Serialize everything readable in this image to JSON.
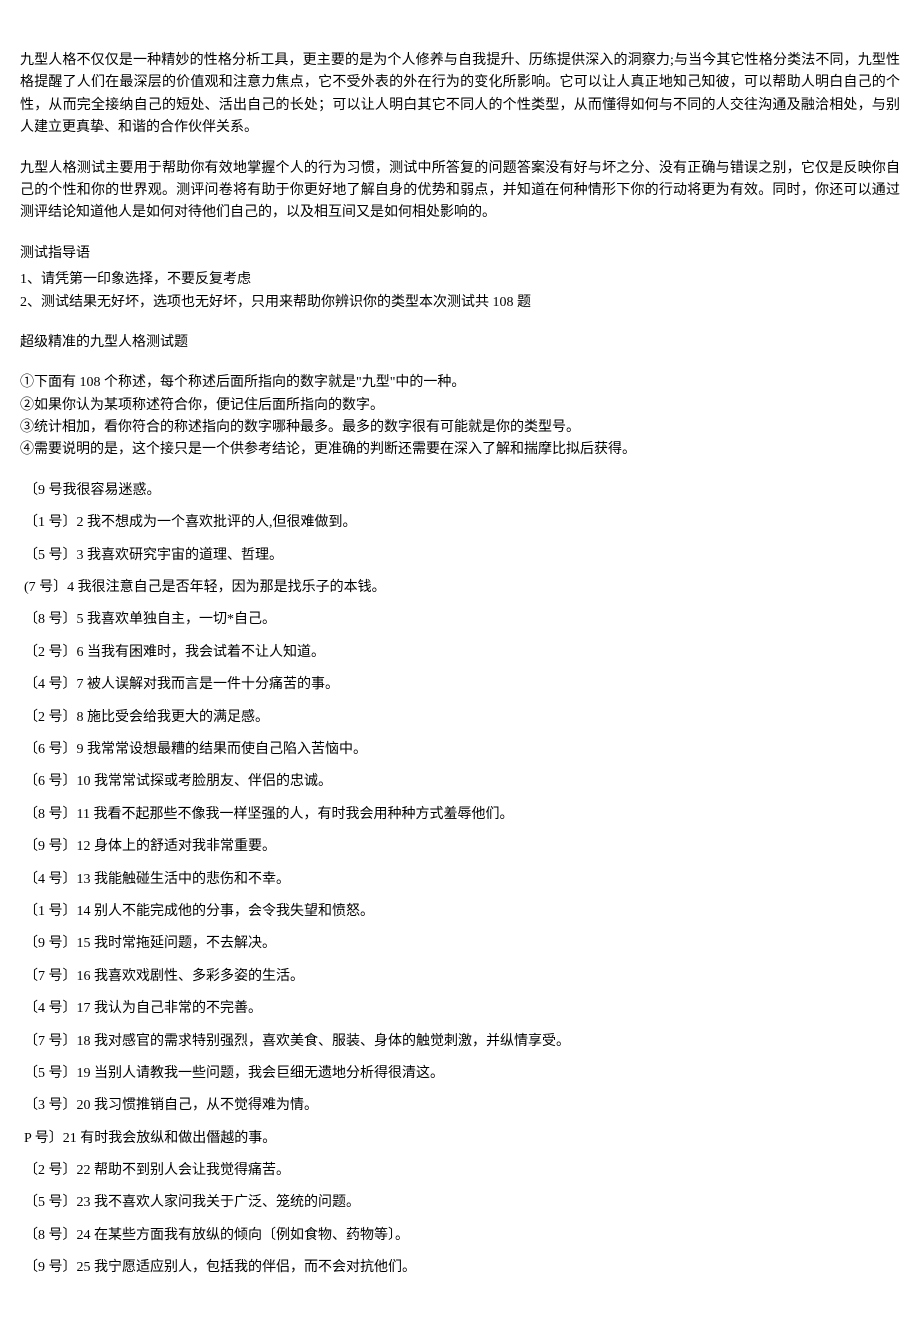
{
  "intro": {
    "p1": "九型人格不仅仅是一种精妙的性格分析工具，更主要的是为个人修养与自我提升、历练提供深入的洞察力;与当今其它性格分类法不同，九型性格提醒了人们在最深层的价值观和注意力焦点，它不受外表的外在行为的变化所影响。它可以让人真正地知己知彼，可以帮助人明白自己的个性，从而完全接纳自己的短处、活出自己的长处；可以让人明白其它不同人的个性类型，从而懂得如何与不同的人交往沟通及融洽相处，与别人建立更真挚、和谐的合作伙伴关系。",
    "p2": "九型人格测试主要用于帮助你有效地掌握个人的行为习惯，测试中所答复的问题答案没有好与坏之分、没有正确与错误之别，它仅是反映你自己的个性和你的世界观。测评问卷将有助于你更好地了解自身的优势和弱点，并知道在何种情形下你的行动将更为有效。同时，你还可以通过测评结论知道他人是如何对待他们自己的，以及相互间又是如何相处影响的。"
  },
  "guide": {
    "heading": "测试指导语",
    "item1": "1、请凭第一印象选择，不要反复考虑",
    "item2": "2、测试结果无好坏，选项也无好坏，只用来帮助你辨识你的类型本次测试共 108 题"
  },
  "subheading": "超级精准的九型人格测试题",
  "rules": {
    "r1": "①下面有 108 个称述，每个称述后面所指向的数字就是\"九型\"中的一种。",
    "r2": "②如果你认为某项称述符合你，便记住后面所指向的数字。",
    "r3": "③统计相加，看你符合的称述指向的数字哪种最多。最多的数字很有可能就是你的类型号。",
    "r4": "④需要说明的是，这个接只是一个供参考结论，更准确的判断还需要在深入了解和揣摩比拟后获得。"
  },
  "questions": [
    {
      "prefix": "〔9 号我很容易迷惑。"
    },
    {
      "prefix": "〔1 号〕2 我不想成为一个喜欢批评的人,但很难做到。"
    },
    {
      "prefix": "〔5 号〕3 我喜欢研究宇宙的道理、哲理。"
    },
    {
      "prefix": "(7 号〕4 我很注意自己是否年轻，因为那是找乐子的本钱。"
    },
    {
      "prefix": "〔8 号〕5 我喜欢单独自主，一切*自己。"
    },
    {
      "prefix": "〔2 号〕6 当我有困难时，我会试着不让人知道。"
    },
    {
      "prefix": "〔4 号〕7 被人误解对我而言是一件十分痛苦的事。"
    },
    {
      "prefix": "〔2 号〕8 施比受会给我更大的满足感。"
    },
    {
      "prefix": "〔6 号〕9 我常常设想最糟的结果而使自己陷入苦恼中。"
    },
    {
      "prefix": "〔6 号〕10 我常常试探或考脸朋友、伴侣的忠诚。"
    },
    {
      "prefix": "〔8 号〕11 我看不起那些不像我一样坚强的人，有时我会用种种方式羞辱他们。"
    },
    {
      "prefix": "〔9 号〕12 身体上的舒适对我非常重要。"
    },
    {
      "prefix": "〔4 号〕13 我能触碰生活中的悲伤和不幸。"
    },
    {
      "prefix": "〔1 号〕14 别人不能完成他的分事，会令我失望和愤怒。"
    },
    {
      "prefix": "〔9 号〕15 我时常拖延问题，不去解决。"
    },
    {
      "prefix": "〔7 号〕16 我喜欢戏剧性、多彩多姿的生活。"
    },
    {
      "prefix": "〔4 号〕17 我认为自己非常的不完善。"
    },
    {
      "prefix": "〔7 号〕18 我对感官的需求特别强烈，喜欢美食、服装、身体的触觉刺激，并纵情享受。"
    },
    {
      "prefix": "〔5 号〕19 当别人请教我一些问题，我会巨细无遗地分析得很清这。"
    },
    {
      "prefix": "〔3 号〕20 我习惯推销自己，从不觉得难为情。"
    },
    {
      "prefix": "P 号〕21 有时我会放纵和做出僭越的事。"
    },
    {
      "prefix": "〔2 号〕22 帮助不到别人会让我觉得痛苦。"
    },
    {
      "prefix": "〔5 号〕23 我不喜欢人家问我关于广泛、笼统的问题。"
    },
    {
      "prefix": "〔8 号〕24 在某些方面我有放纵的倾向〔例如食物、药物等〕。"
    },
    {
      "prefix": "〔9 号〕25 我宁愿适应别人，包括我的伴侣，而不会对抗他们。"
    }
  ]
}
